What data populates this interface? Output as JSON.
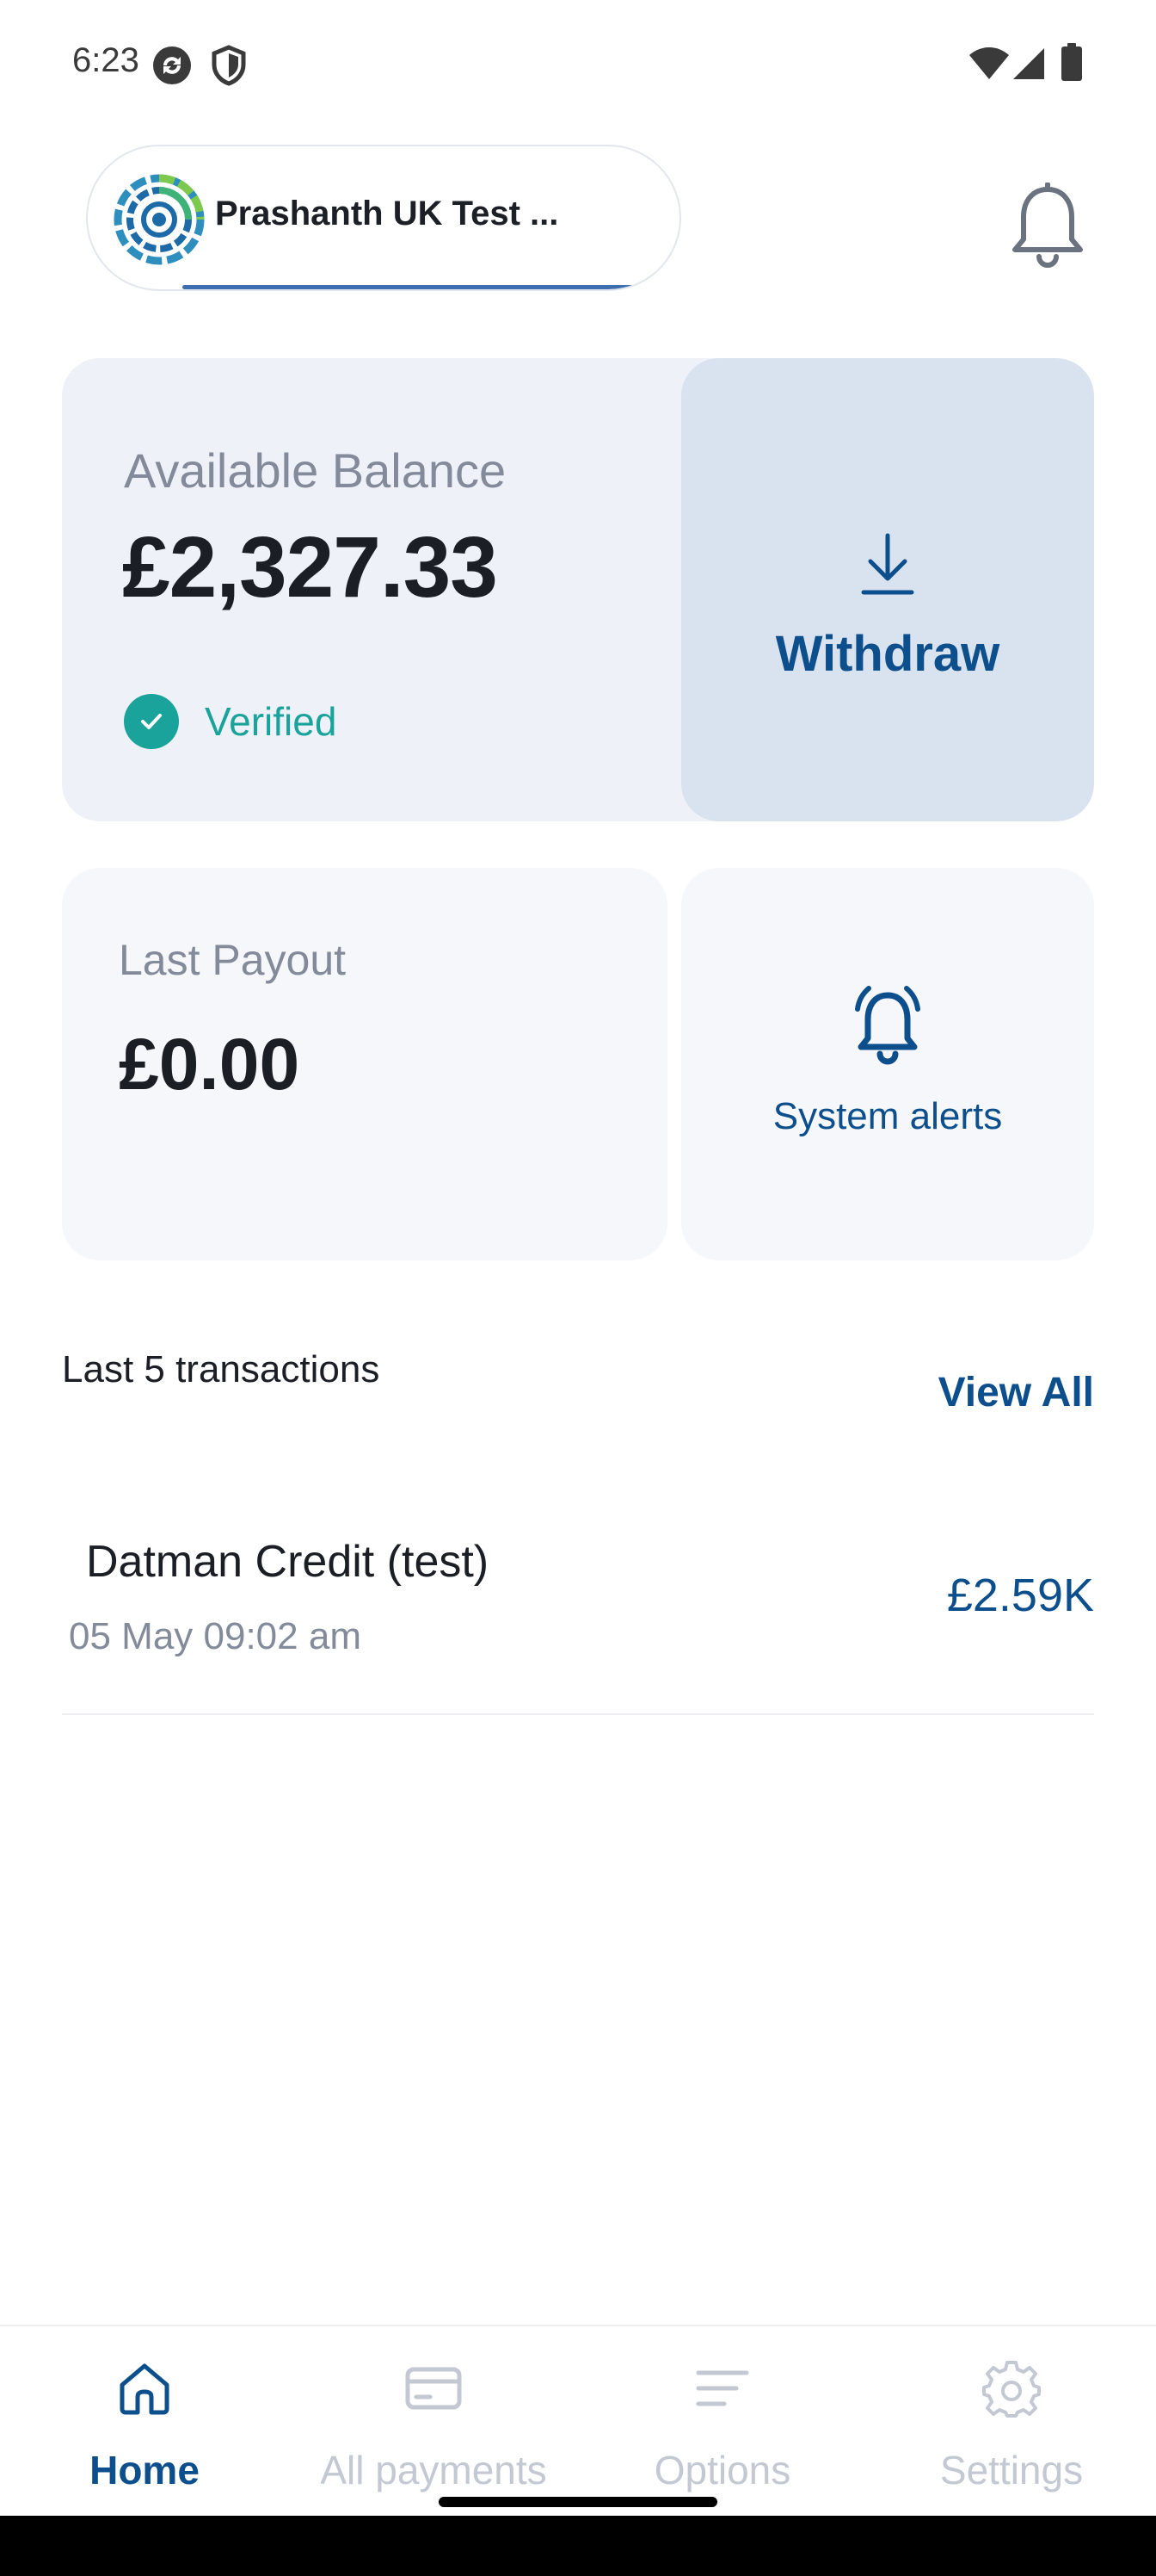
{
  "status_bar": {
    "time": "6:23",
    "icons": [
      "sync-icon",
      "shield-icon",
      "wifi-icon",
      "signal-icon",
      "battery-icon"
    ]
  },
  "header": {
    "merchant_name": "Prashanth UK Test ...",
    "notification_icon": "bell-icon"
  },
  "balance": {
    "label": "Available Balance",
    "value": "£2,327.33",
    "verified_label": "Verified",
    "withdraw_label": "Withdraw"
  },
  "payout": {
    "label": "Last Payout",
    "value": "£0.00"
  },
  "alerts": {
    "label": "System alerts"
  },
  "transactions": {
    "heading": "Last 5 transactions",
    "view_all": "View All",
    "items": [
      {
        "title": "Datman Credit (test)",
        "date": "05 May 09:02 am",
        "amount": "£2.59K"
      }
    ]
  },
  "nav": {
    "items": [
      {
        "label": "Home",
        "icon": "home-icon",
        "active": true
      },
      {
        "label": "All payments",
        "icon": "card-icon",
        "active": false
      },
      {
        "label": "Options",
        "icon": "menu-icon",
        "active": false
      },
      {
        "label": "Settings",
        "icon": "gear-icon",
        "active": false
      }
    ]
  },
  "colors": {
    "accent": "#0d4f8c",
    "verified": "#1aa39a",
    "card_bg": "#eef2f8",
    "withdraw_bg": "#d9e2ef",
    "muted": "#838a9a",
    "nav_inactive": "#c3c8d3"
  }
}
